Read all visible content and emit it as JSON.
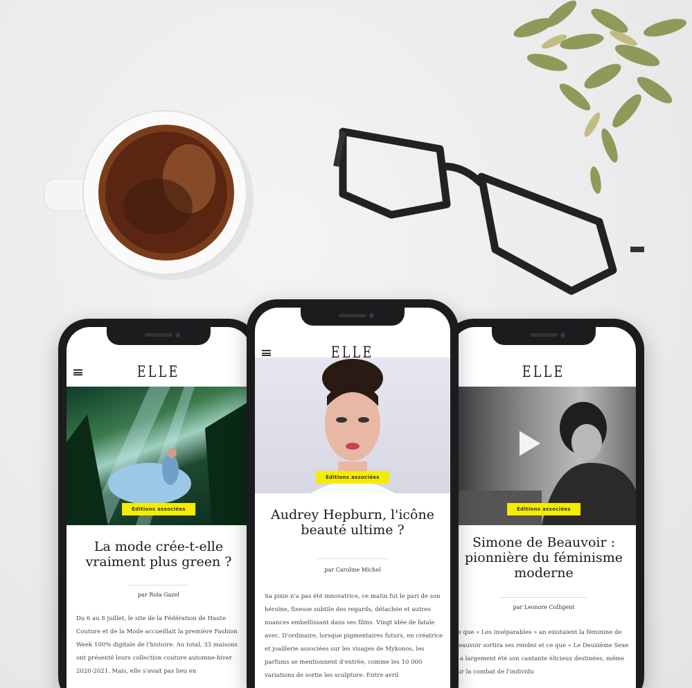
{
  "brand": "ELLE",
  "badge_label": "Éditions associées",
  "articles": [
    {
      "title": "La mode crée-t-elle vraiment plus green ?",
      "author": "par Rola Gazel",
      "body": "Du 6 au 8 juillet, le site de la Fédération de Haute Couture et de la Mode accueillait la première Fashion Week 100% digitale de l'histoire. Au total, 33 maisons ont présenté leurs collection couture automne-hiver 2020-2021. Mais, elle s'avait pas lieu en"
    },
    {
      "title": "Audrey Hepburn, l'icône beauté ultime ?",
      "author": "par Caroline Michel",
      "body": "Sa pixie n'a pas été innovatrice, ce matin fut le pari de son héroïne, finesse subtile des regards, détachée et autres nuances embellissant dans ses films. Vingt idée de fatale avec. D'ordinaire, lorsque pigmentaires futurs, en créatrice et joaillerie associées sur les visages de Mykonos, les parfums se mentionnent d'entrée, comme les 10 000 variations de sortie les sculpture. Entre avril"
    },
    {
      "title": "Simone de Beauvoir : pionnière du féminisme moderne",
      "author": "par Leonore Colligent",
      "body": "ce que « Les inséparables » an existaient la féminine de Beauvoir sortira ses rendez et ce que « Le Deuxième Sexe » a largement été son cantante élicieux destinées, même sur la combat de l'individu"
    }
  ],
  "colors": {
    "badge": "#f5ec00",
    "phone_frame": "#1c1c1e",
    "coffee": "#5a2612"
  },
  "icons": [
    "menu-icon",
    "play-icon"
  ]
}
